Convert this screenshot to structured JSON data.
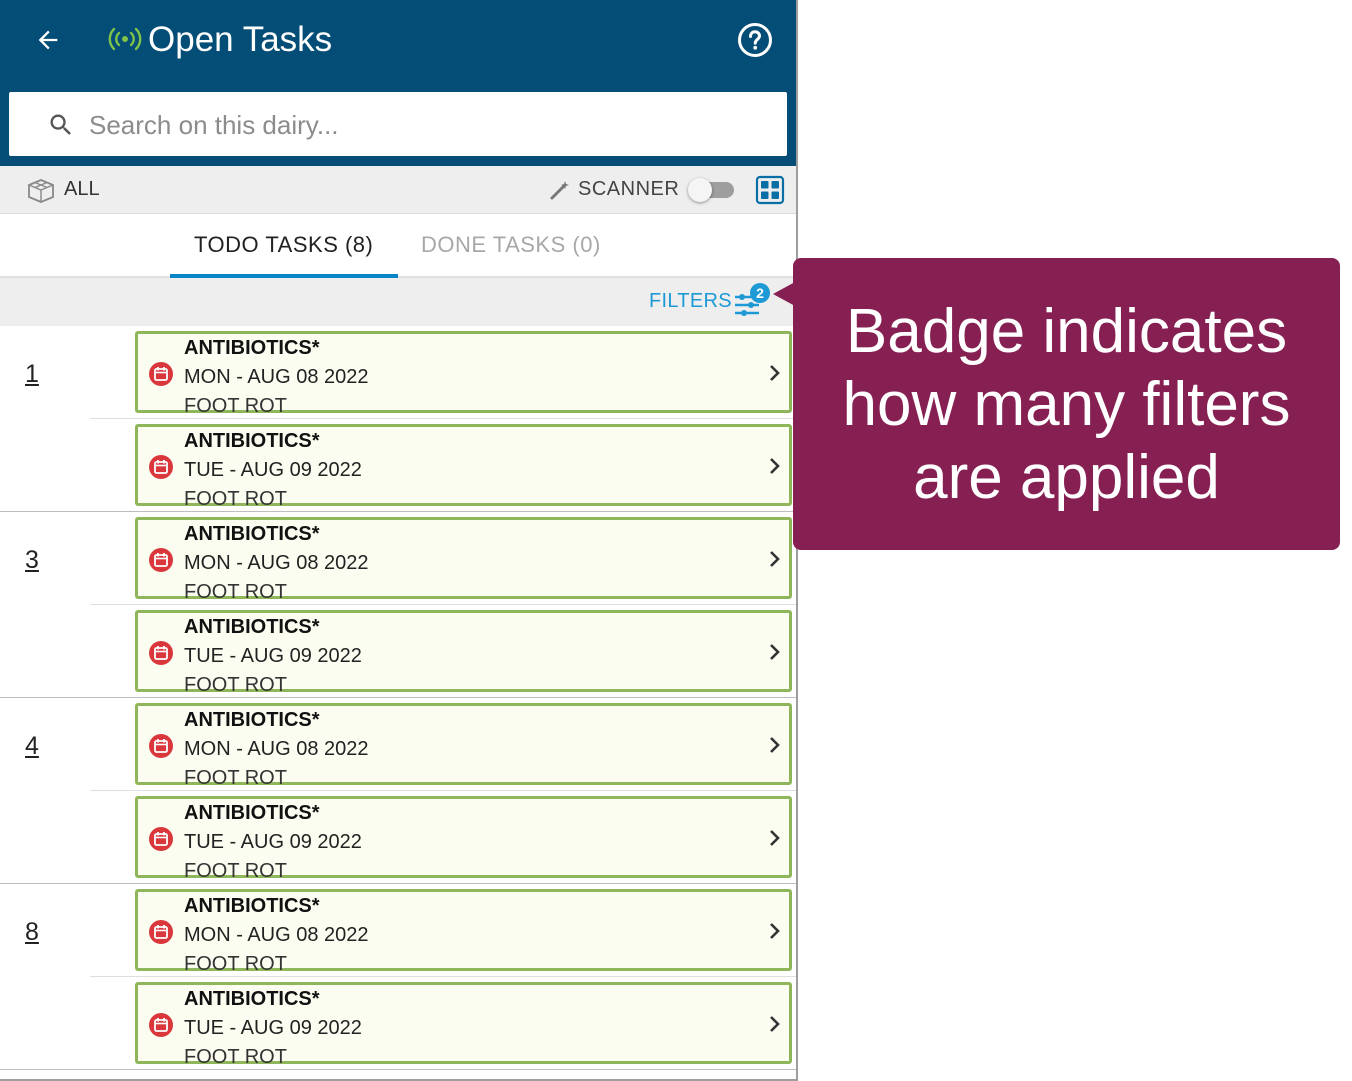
{
  "header": {
    "title": "Open Tasks"
  },
  "search": {
    "placeholder": "Search on this dairy..."
  },
  "toolbar": {
    "all_label": "ALL",
    "scanner_label": "SCANNER",
    "scanner_on": false
  },
  "tabs": [
    {
      "label": "TODO TASKS (8)",
      "active": true
    },
    {
      "label": "DONE TASKS (0)",
      "active": false
    }
  ],
  "filters": {
    "label": "FILTERS",
    "badge_count": "2"
  },
  "groups": [
    {
      "id": "1",
      "tasks": [
        {
          "title": "ANTIBIOTICS*",
          "date": "MON - AUG 08 2022",
          "note": "FOOT ROT"
        },
        {
          "title": "ANTIBIOTICS*",
          "date": "TUE - AUG 09 2022",
          "note": "FOOT ROT"
        }
      ]
    },
    {
      "id": "3",
      "tasks": [
        {
          "title": "ANTIBIOTICS*",
          "date": "MON - AUG 08 2022",
          "note": "FOOT ROT"
        },
        {
          "title": "ANTIBIOTICS*",
          "date": "TUE - AUG 09 2022",
          "note": "FOOT ROT"
        }
      ]
    },
    {
      "id": "4",
      "tasks": [
        {
          "title": "ANTIBIOTICS*",
          "date": "MON - AUG 08 2022",
          "note": "FOOT ROT"
        },
        {
          "title": "ANTIBIOTICS*",
          "date": "TUE - AUG 09 2022",
          "note": "FOOT ROT"
        }
      ]
    },
    {
      "id": "8",
      "tasks": [
        {
          "title": "ANTIBIOTICS*",
          "date": "MON - AUG 08 2022",
          "note": "FOOT ROT"
        },
        {
          "title": "ANTIBIOTICS*",
          "date": "TUE - AUG 09 2022",
          "note": "FOOT ROT"
        }
      ]
    }
  ],
  "callout": {
    "text": "Badge indicates how many filters are applied"
  },
  "icons": {
    "back": "arrow-back-icon",
    "signal": "signal-broadcast-icon",
    "help": "help-circle-icon",
    "search": "search-icon",
    "all": "cow-icon",
    "scanner": "wand-icon",
    "grid": "grid-view-icon",
    "filters": "tune-sliders-icon",
    "task": "calendar-icon",
    "chevron": "chevron-right-icon"
  },
  "colors": {
    "appbar": "#044d76",
    "signal": "#7ec24a",
    "accent_blue": "#1d9ad6",
    "card_border": "#8fb65a",
    "card_bg": "#fbfdf1",
    "calendar_red": "#d9373c",
    "callout_bg": "#862052"
  }
}
